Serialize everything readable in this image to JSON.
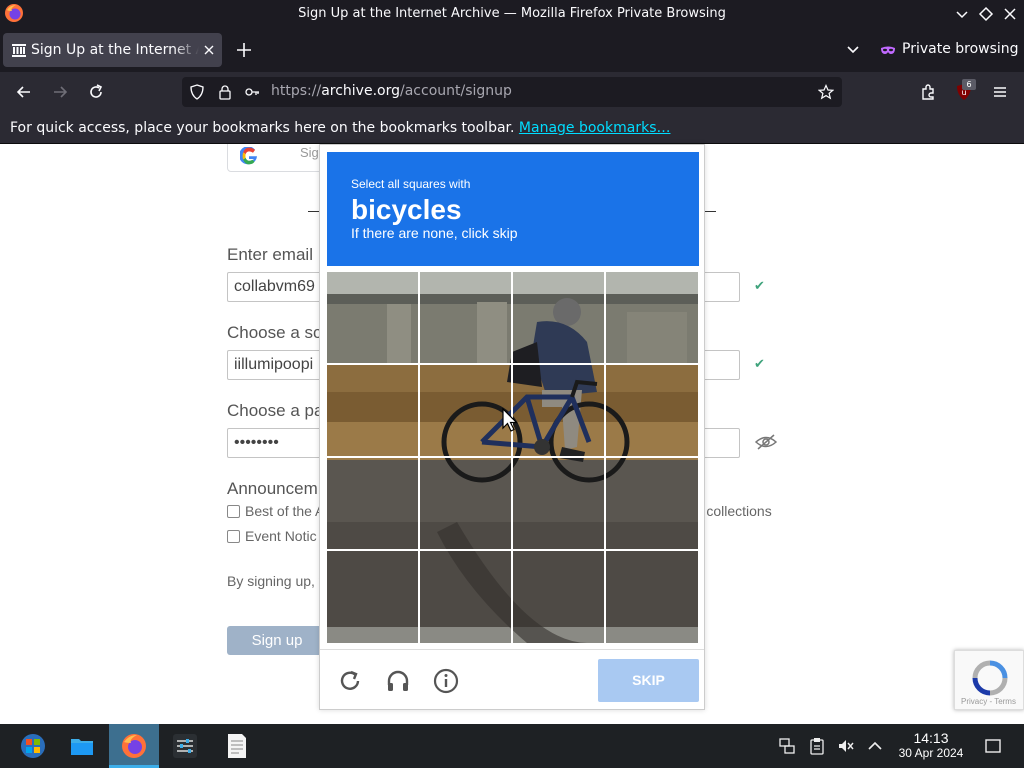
{
  "window": {
    "title": "Sign Up at the Internet Archive — Mozilla Firefox Private Browsing"
  },
  "tabs": [
    {
      "title": "Sign Up at the Internet Archive"
    }
  ],
  "private_label": "Private browsing",
  "url": {
    "scheme": "https://",
    "host": "archive.org",
    "path": "/account/signup"
  },
  "extension_badge": "6",
  "bookmarks_bar": {
    "message": "For quick access, place your bookmarks here on the bookmarks toolbar.",
    "link": "Manage bookmarks…"
  },
  "form": {
    "google_button_text": "Sig",
    "email_label": "Enter email",
    "email_value": "collabvm69",
    "screenname_label": "Choose a sc",
    "screenname_value": "iillumipoopi",
    "password_label": "Choose a pa",
    "password_value": "••••••••",
    "announcements_label": "Announcem",
    "checkbox_1": "Best of the A",
    "checkbox_2": "Event Notic",
    "checkbox_1_tail": "ur collections",
    "terms": "By signing up, y",
    "signup_button": "Sign up"
  },
  "recaptcha_badge": {
    "links": "Privacy - Terms"
  },
  "captcha": {
    "instruction": "Select all squares with",
    "target": "bicycles",
    "hint": "If there are none, click skip",
    "skip_button": "SKIP",
    "grid": {
      "rows": 4,
      "cols": 4
    }
  },
  "colors": {
    "captcha_header": "#1a73e8",
    "skip_button": "#a9c9f2",
    "valid_check": "#3fa37c"
  },
  "taskbar": {
    "time": "14:13",
    "date": "30 Apr 2024"
  }
}
